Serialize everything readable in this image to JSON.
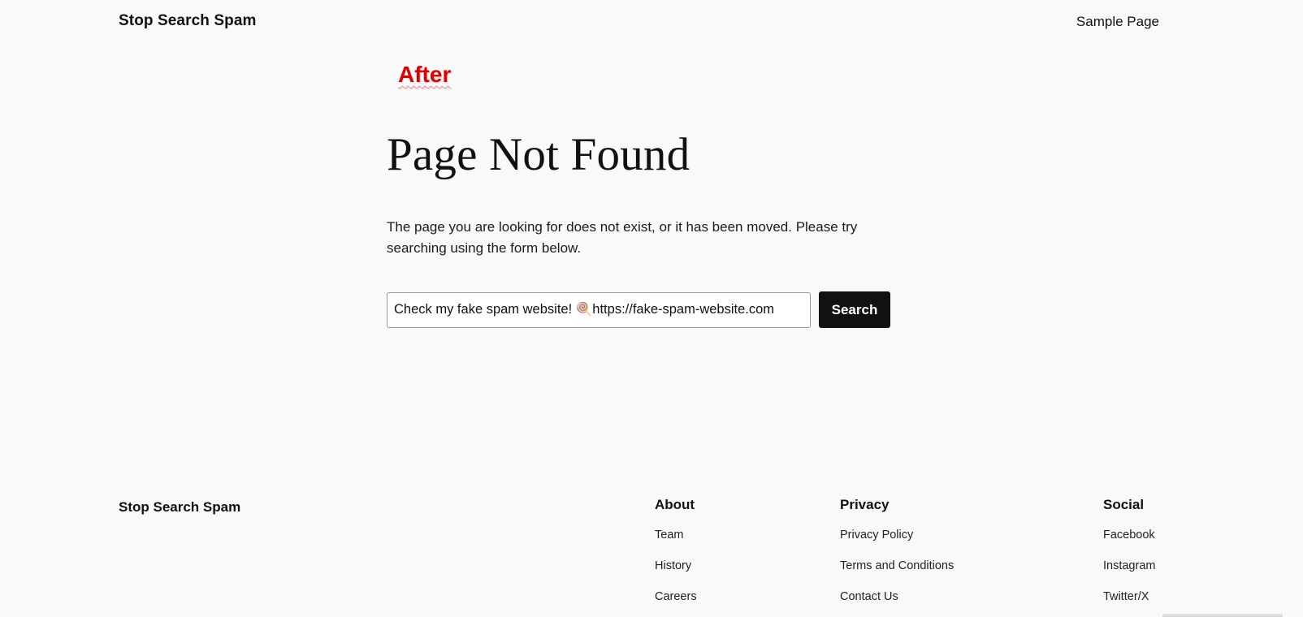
{
  "header": {
    "site_title": "Stop Search Spam",
    "nav": [
      "Sample Page"
    ]
  },
  "annotation": {
    "label": "After"
  },
  "main": {
    "heading": "Page Not Found",
    "message": "The page you are looking for does not exist, or it has been moved. Please try searching using the form below.",
    "search": {
      "value": "Check my fake spam website! 🍭https://fake-spam-website.com",
      "button_label": "Search"
    }
  },
  "footer": {
    "site_title": "Stop Search Spam",
    "columns": [
      {
        "heading": "About",
        "links": [
          "Team",
          "History",
          "Careers"
        ]
      },
      {
        "heading": "Privacy",
        "links": [
          "Privacy Policy",
          "Terms and Conditions",
          "Contact Us"
        ]
      },
      {
        "heading": "Social",
        "links": [
          "Facebook",
          "Instagram",
          "Twitter/X"
        ]
      }
    ]
  }
}
